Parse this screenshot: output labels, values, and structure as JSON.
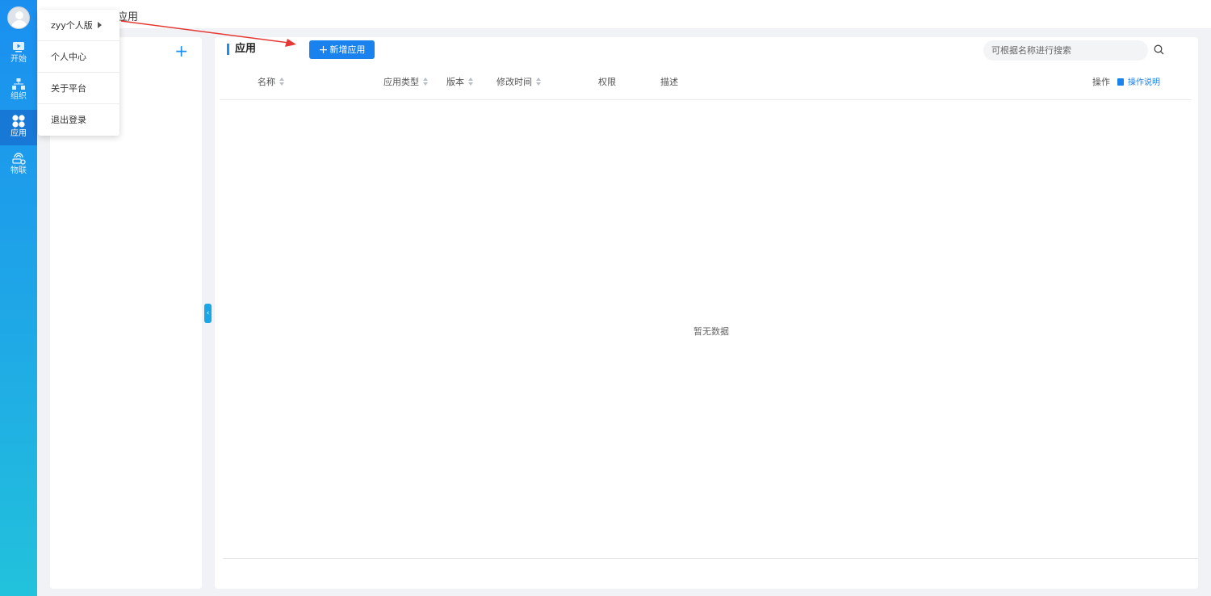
{
  "sidenav": {
    "items": [
      {
        "label": "开始",
        "icon": "video-icon"
      },
      {
        "label": "组织",
        "icon": "org-chart-icon"
      },
      {
        "label": "应用",
        "icon": "apps-icon"
      },
      {
        "label": "物联",
        "icon": "iot-icon"
      }
    ],
    "active": "应用"
  },
  "breadcrumb": {
    "text": "应用"
  },
  "user_menu": {
    "items": [
      {
        "label": "zyy个人版"
      },
      {
        "label": "个人中心"
      },
      {
        "label": "关于平台"
      },
      {
        "label": "退出登录"
      }
    ]
  },
  "main": {
    "title": "应用",
    "add_button_label": "新增应用",
    "search_placeholder": "可根据名称进行搜索",
    "columns": [
      "名称",
      "应用类型",
      "版本",
      "修改时间",
      "权限",
      "描述",
      "操作"
    ],
    "help_link_label": "操作说明",
    "empty_text": "暂无数据"
  },
  "colors": {
    "accent": "#1a82ef",
    "sidebar_top": "#1a8ff0",
    "sidebar_bottom": "#22c2dc",
    "annotation_arrow": "#e53935"
  }
}
